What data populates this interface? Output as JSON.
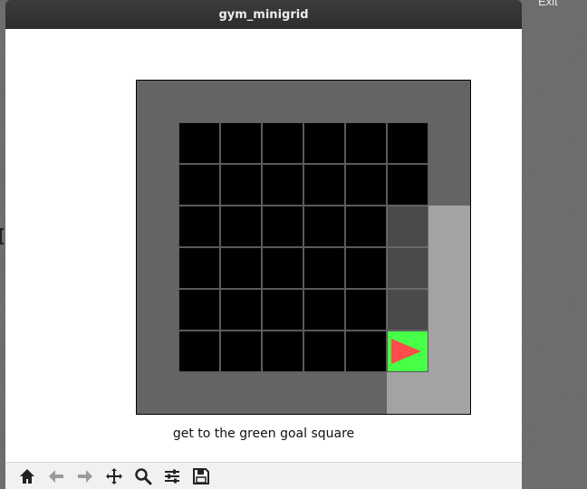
{
  "window": {
    "title": "gym_minigrid"
  },
  "desktop": {
    "exit_label": "Exit"
  },
  "game": {
    "mission": "get to the green goal square",
    "grid_size": [
      8,
      8
    ],
    "agent": {
      "col": 6,
      "row": 6,
      "direction": "right",
      "color": "#ff4b4b"
    },
    "goal": {
      "col": 6,
      "row": 6,
      "color": "#46ff46"
    },
    "visible_cells": [
      [
        6,
        3
      ],
      [
        7,
        3
      ],
      [
        6,
        4
      ],
      [
        7,
        4
      ],
      [
        6,
        5
      ],
      [
        7,
        5
      ],
      [
        6,
        6
      ],
      [
        7,
        6
      ],
      [
        6,
        7
      ],
      [
        7,
        7
      ]
    ]
  },
  "toolbar": {
    "buttons": [
      {
        "name": "home-button",
        "icon": "home-icon",
        "enabled": true
      },
      {
        "name": "back-button",
        "icon": "arrow-left-icon",
        "enabled": false
      },
      {
        "name": "forward-button",
        "icon": "arrow-right-icon",
        "enabled": false
      },
      {
        "name": "pan-button",
        "icon": "move-icon",
        "enabled": true
      },
      {
        "name": "zoom-button",
        "icon": "zoom-icon",
        "enabled": true
      },
      {
        "name": "configure-subplots-button",
        "icon": "sliders-icon",
        "enabled": true
      },
      {
        "name": "save-button",
        "icon": "save-icon",
        "enabled": true
      }
    ]
  }
}
